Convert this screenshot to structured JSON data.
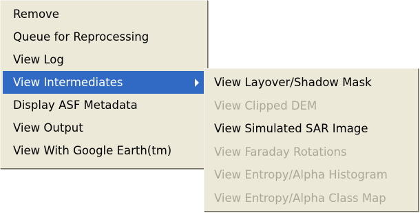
{
  "main_menu": {
    "items": [
      {
        "label": "Remove"
      },
      {
        "label": "Queue for Reprocessing"
      },
      {
        "label": "View Log"
      },
      {
        "label": "View Intermediates",
        "selected": true,
        "has_submenu": true
      },
      {
        "label": "Display ASF Metadata"
      },
      {
        "label": "View Output"
      },
      {
        "label": "View With Google Earth(tm)"
      }
    ]
  },
  "sub_menu": {
    "items": [
      {
        "label": "View Layover/Shadow Mask",
        "enabled": true
      },
      {
        "label": "View Clipped DEM",
        "enabled": false
      },
      {
        "label": "View Simulated SAR Image",
        "enabled": true
      },
      {
        "label": "View Faraday Rotations",
        "enabled": false
      },
      {
        "label": "View Entropy/Alpha Histogram",
        "enabled": false
      },
      {
        "label": "View Entropy/Alpha Class Map",
        "enabled": false
      }
    ]
  },
  "colors": {
    "menu_background": "#ece9d8",
    "selection_background": "#316ac5",
    "selection_text": "#ffffff",
    "disabled_text": "#aca899",
    "text": "#000000"
  },
  "icons": {
    "submenu_arrow": "submenu-arrow-icon"
  }
}
